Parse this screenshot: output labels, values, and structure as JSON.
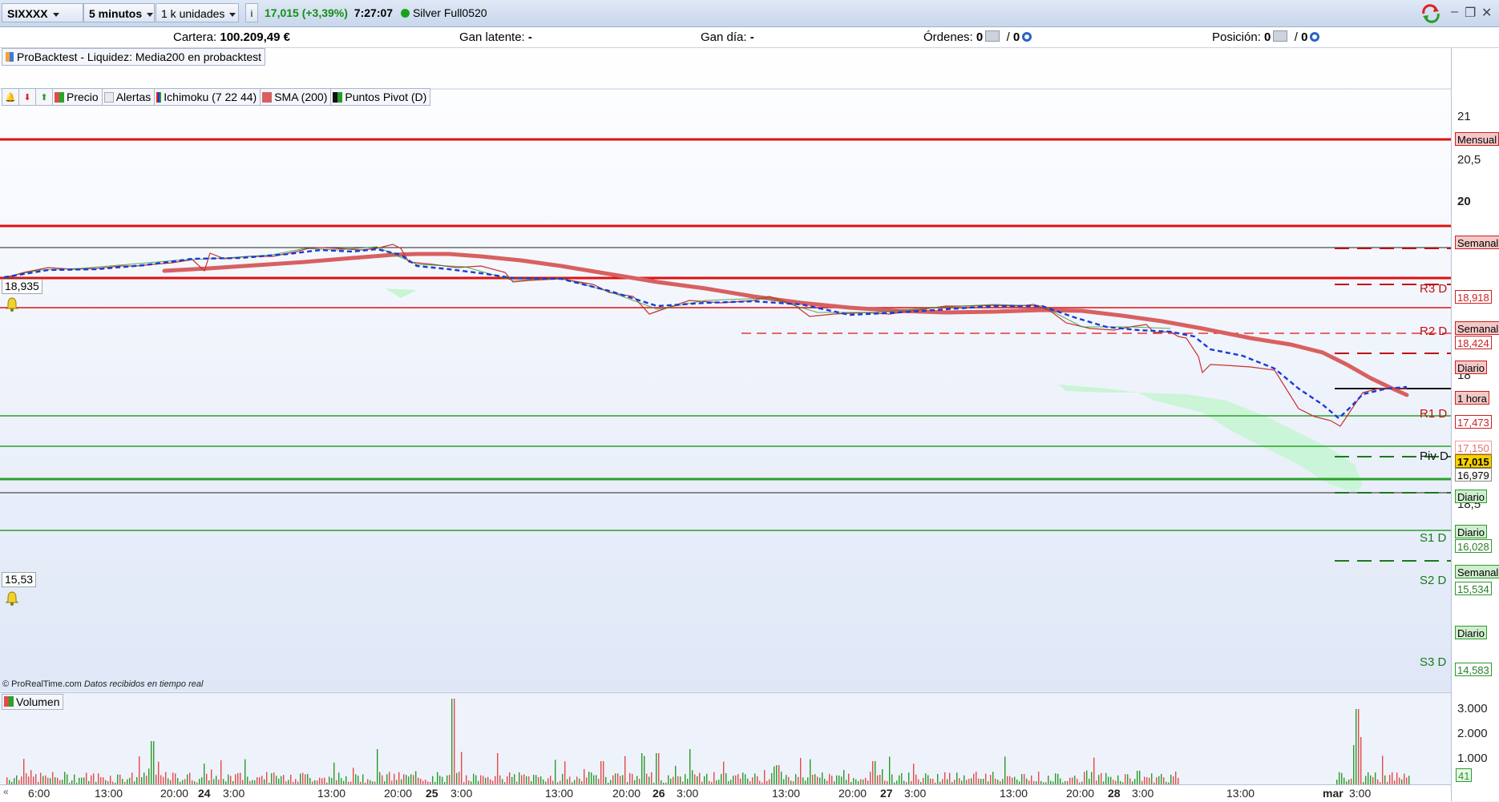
{
  "toolbar": {
    "symbol": "SIXXXX",
    "timeframe": "5 minutos",
    "units": "1 k unidades",
    "info_icon": "info-icon",
    "last_price": "17,015 (+3,39%)",
    "time": "7:27:07",
    "status": "Silver Full0520",
    "status_color": "#1aa31a"
  },
  "account": {
    "cartera_label": "Cartera:",
    "cartera_value": "100.209,49 €",
    "gan_latente_label": "Gan latente:",
    "gan_latente_value": "-",
    "gan_dia_label": "Gan día:",
    "gan_dia_value": "-",
    "ordenes_label": "Órdenes:",
    "ordenes_a": "0",
    "ordenes_sep": "/",
    "ordenes_b": "0",
    "posicion_label": "Posición:",
    "posicion_a": "0",
    "posicion_sep": "/",
    "posicion_b": "0"
  },
  "backtest_label": "ProBacktest - Liquidez: Media200 en probacktest",
  "legend": {
    "precio": "Precio",
    "alertas": "Alertas",
    "ichimoku": "Ichimoku (7 22 44)",
    "sma": "SMA (200)",
    "pivots": "Puntos Pivot (D)"
  },
  "levels_left": {
    "upper": "18,935",
    "lower": "15,53"
  },
  "price_axis": {
    "ticks": [
      "21",
      "20,5",
      "20",
      "18",
      "18,5"
    ],
    "ticks_bold": [
      "20"
    ]
  },
  "price_labels": [
    {
      "text": "Mensual",
      "bg": "#f4c8c8",
      "border": "#cc2020",
      "color": "#000"
    },
    {
      "text": "Semanal",
      "bg": "#f4c8c8",
      "border": "#cc2020",
      "color": "#000"
    },
    {
      "text": "18,918",
      "bg": "#ffffff",
      "border": "#cc2020",
      "color": "#cc2020"
    },
    {
      "text": "Semanal",
      "bg": "#f4c8c8",
      "border": "#cc2020",
      "color": "#000"
    },
    {
      "text": "18,424",
      "bg": "#ffffff",
      "border": "#cc2020",
      "color": "#cc2020"
    },
    {
      "text": "Diario",
      "bg": "#f4c8c8",
      "border": "#cc2020",
      "color": "#000"
    },
    {
      "text": "1 hora",
      "bg": "#f4c8c8",
      "border": "#cc2020",
      "color": "#000"
    },
    {
      "text": "17,473",
      "bg": "#ffffff",
      "border": "#cc2020",
      "color": "#cc2020"
    },
    {
      "text": "17,150",
      "bg": "#ffffff",
      "border": "#f0a0a0",
      "color": "#e07070"
    },
    {
      "text": "17,015",
      "bg": "#f5d200",
      "border": "#8a7000",
      "color": "#000"
    },
    {
      "text": "16,979",
      "bg": "#ffffff",
      "border": "#888888",
      "color": "#000"
    },
    {
      "text": "Diario",
      "bg": "#cfeecf",
      "border": "#2a9a2a",
      "color": "#000"
    },
    {
      "text": "Diario",
      "bg": "#cfeecf",
      "border": "#2a9a2a",
      "color": "#000"
    },
    {
      "text": "16,028",
      "bg": "#ffffff",
      "border": "#2a9a2a",
      "color": "#2a7a2a"
    },
    {
      "text": "Semanal",
      "bg": "#cfeecf",
      "border": "#2a9a2a",
      "color": "#000"
    },
    {
      "text": "15,534",
      "bg": "#ffffff",
      "border": "#2a9a2a",
      "color": "#2a7a2a"
    },
    {
      "text": "Diario",
      "bg": "#cfeecf",
      "border": "#2a9a2a",
      "color": "#000"
    },
    {
      "text": "14,583",
      "bg": "#ffffff",
      "border": "#2a9a2a",
      "color": "#2a7a2a"
    }
  ],
  "pivots": {
    "r3": "R3 D",
    "r2": "R2 D",
    "r1": "R1 D",
    "piv": "Piv D",
    "s1": "S1 D",
    "s2": "S2 D",
    "s3": "S3 D"
  },
  "volume": {
    "label": "Volumen",
    "ticks": [
      "3.000",
      "2.000",
      "1.000"
    ],
    "last": "41"
  },
  "copyright": "© ProRealTime.com",
  "copyright_note": "Datos recibidos en tiempo real",
  "time_axis": [
    {
      "text": "6:00",
      "bold": false
    },
    {
      "text": "13:00",
      "bold": false
    },
    {
      "text": "20:00",
      "bold": false
    },
    {
      "text": "24",
      "bold": true
    },
    {
      "text": "3:00",
      "bold": false
    },
    {
      "text": "13:00",
      "bold": false
    },
    {
      "text": "20:00",
      "bold": false
    },
    {
      "text": "25",
      "bold": true
    },
    {
      "text": "3:00",
      "bold": false
    },
    {
      "text": "13:00",
      "bold": false
    },
    {
      "text": "20:00",
      "bold": false
    },
    {
      "text": "26",
      "bold": true
    },
    {
      "text": "3:00",
      "bold": false
    },
    {
      "text": "13:00",
      "bold": false
    },
    {
      "text": "20:00",
      "bold": false
    },
    {
      "text": "27",
      "bold": true
    },
    {
      "text": "3:00",
      "bold": false
    },
    {
      "text": "13:00",
      "bold": false
    },
    {
      "text": "20:00",
      "bold": false
    },
    {
      "text": "28",
      "bold": true
    },
    {
      "text": "3:00",
      "bold": false
    },
    {
      "text": "13:00",
      "bold": false
    },
    {
      "text": "mar",
      "bold": true
    },
    {
      "text": "3:00",
      "bold": false
    }
  ]
}
